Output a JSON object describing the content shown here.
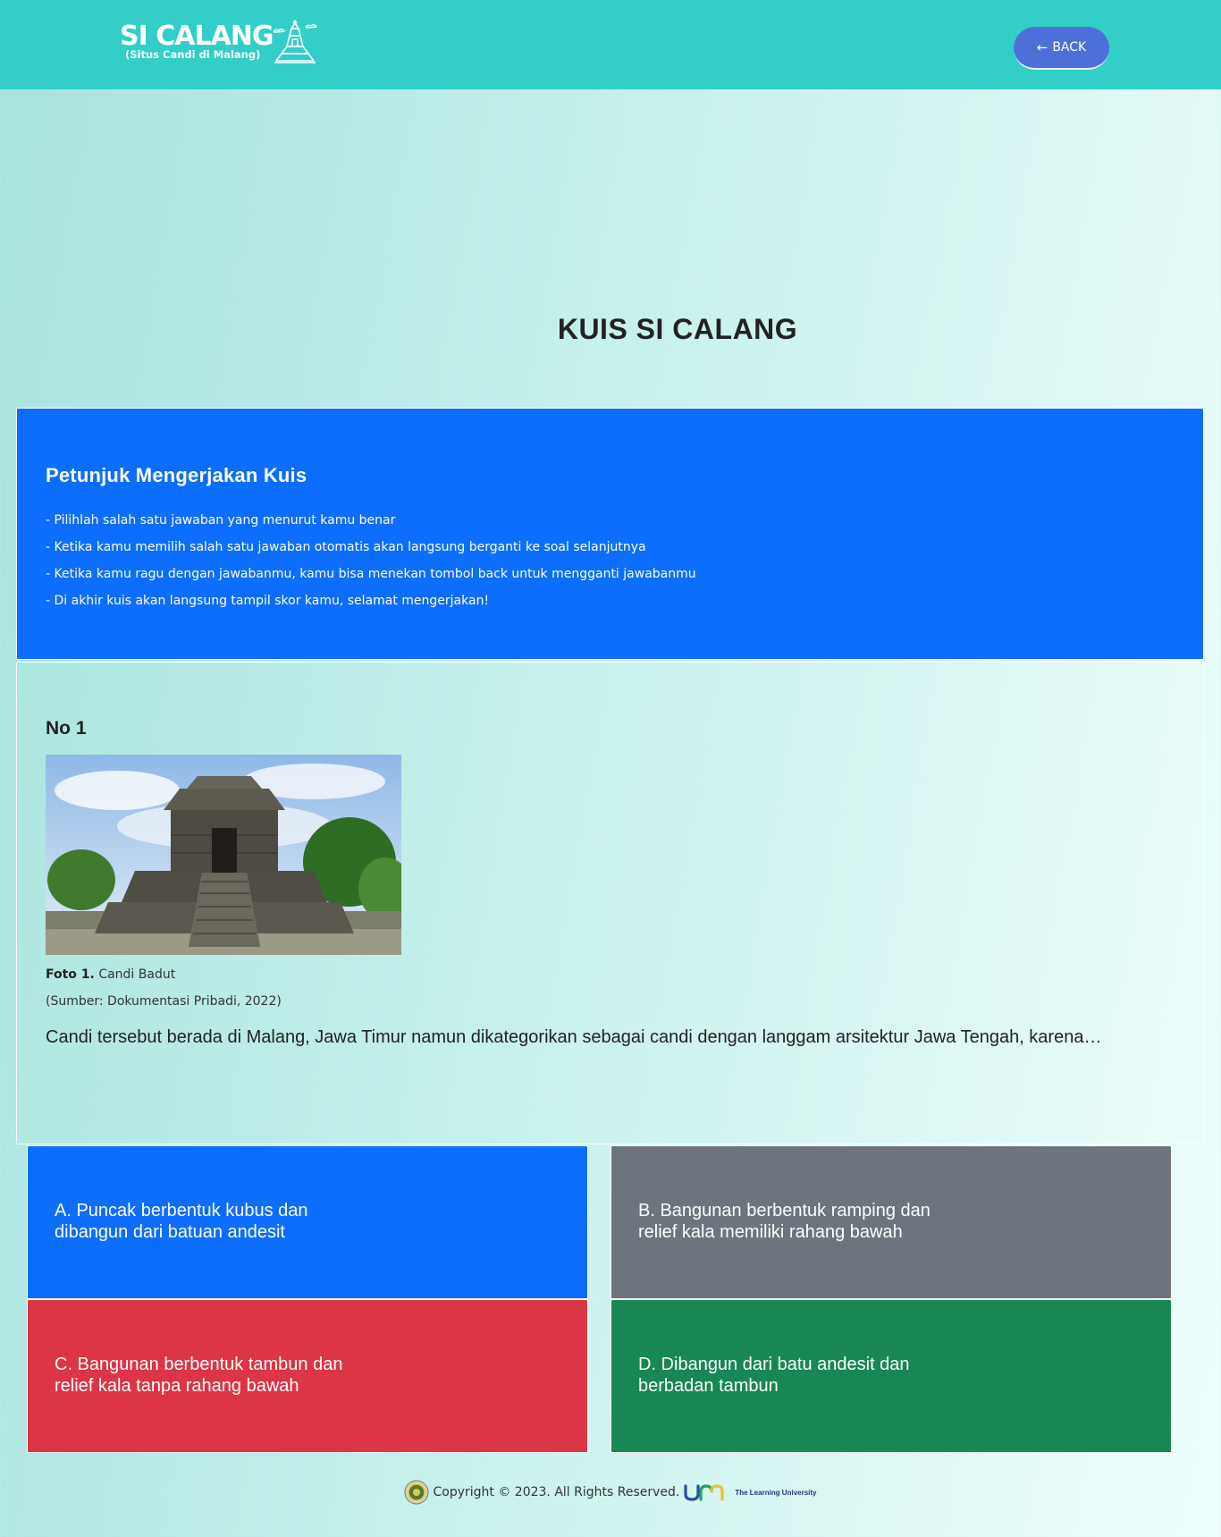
{
  "header": {
    "logo_title": "SI CALANG",
    "logo_subtitle": "(Situs Candi di Malang)",
    "back_label": "BACK"
  },
  "page_title": "KUIS SI CALANG",
  "instructions": {
    "title": "Petunjuk Mengerjakan Kuis",
    "items": [
      "- Pilihlah salah satu jawaban yang menurut kamu benar",
      "- Ketika kamu memilih salah satu jawaban otomatis akan langsung berganti ke soal selanjutnya",
      "- Ketika kamu ragu dengan jawabanmu, kamu bisa menekan tombol back untuk mengganti jawabanmu",
      "- Di akhir kuis akan langsung tampil skor kamu, selamat mengerjakan!"
    ]
  },
  "question": {
    "number": "No 1",
    "caption_label": "Foto 1.",
    "caption_title": "Candi Badut",
    "caption_source": "(Sumber: Dokumentasi Pribadi, 2022)",
    "text": "Candi tersebut berada di Malang, Jawa Timur namun dikategorikan sebagai candi dengan langgam arsitektur Jawa Tengah, karena…"
  },
  "answers": [
    {
      "line1": "A. Puncak berbentuk kubus dan",
      "line2": "dibangun dari batuan andesit",
      "color": "#0d6efd"
    },
    {
      "line1": "B. Bangunan berbentuk ramping dan",
      "line2": "relief kala memiliki rahang bawah",
      "color": "#6c757d"
    },
    {
      "line1": "C. Bangunan berbentuk tambun dan",
      "line2": "relief kala tanpa rahang bawah",
      "color": "#dc3545"
    },
    {
      "line1": "D. Dibangun dari batu andesit dan",
      "line2": "berbadan tambun",
      "color": "#198754"
    }
  ],
  "footer": {
    "copyright": "Copyright © 2023. All Rights Reserved.",
    "tagline": "The Learning University"
  },
  "colors": {
    "header": "#33cec8",
    "back_button": "#4c6fd8",
    "instructions": "#0d6efd"
  }
}
